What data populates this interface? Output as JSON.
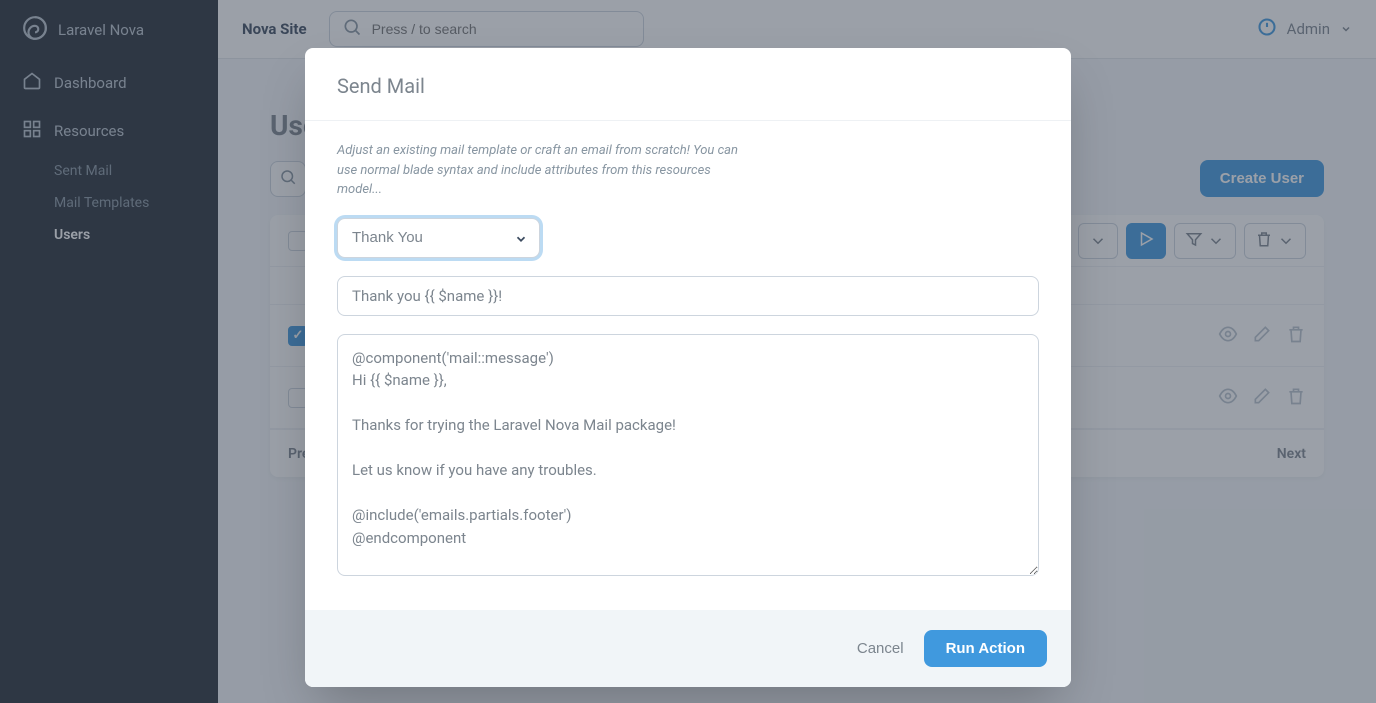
{
  "brand": {
    "main": "Laravel",
    "sub": "Nova"
  },
  "sidebar": {
    "dashboard": "Dashboard",
    "resources": "Resources",
    "items": [
      {
        "label": "Sent Mail",
        "active": false
      },
      {
        "label": "Mail Templates",
        "active": false
      },
      {
        "label": "Users",
        "active": true
      }
    ]
  },
  "topbar": {
    "site_name": "Nova Site",
    "search_placeholder": "Press / to search",
    "user_name": "Admin"
  },
  "page": {
    "title": "Users",
    "create_button": "Create User",
    "previous": "Previous",
    "next": "Next"
  },
  "modal": {
    "title": "Send Mail",
    "help": "Adjust an existing mail template or craft an email from scratch! You can use normal blade syntax and include attributes from this resources model...",
    "template_select": "Thank You",
    "subject": "Thank you {{ $name }}!",
    "body": "@component('mail::message')\nHi {{ $name }},\n\nThanks for trying the Laravel Nova Mail package!\n\nLet us know if you have any troubles.\n\n@include('emails.partials.footer')\n@endcomponent",
    "cancel": "Cancel",
    "run": "Run Action"
  }
}
